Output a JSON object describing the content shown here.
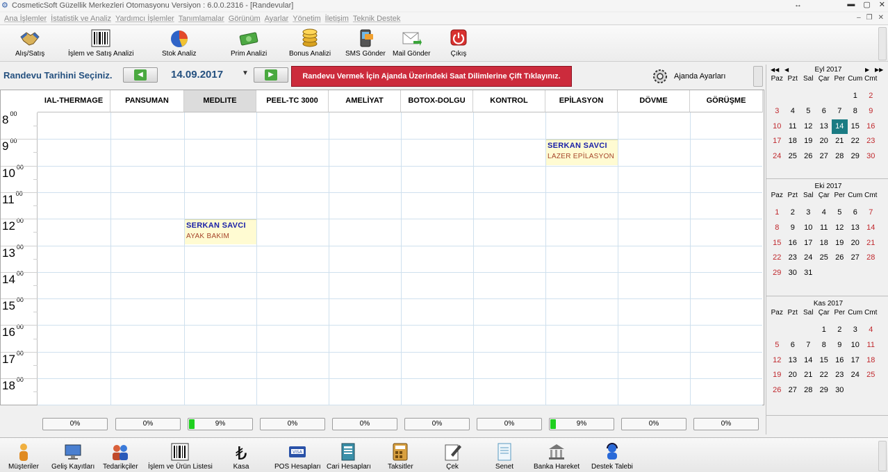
{
  "window": {
    "title": "CosmeticSoft Güzellik Merkezleri Otomasyonu Versiyon : 6.0.0.2316 - [Randevular]"
  },
  "menu": [
    "Ana İşlemler",
    "İstatistik ve Analiz",
    "Yardımcı İşlemler",
    "Tanımlamalar",
    "Görünüm",
    "Ayarlar",
    "Yönetim",
    "İletişim",
    "Teknik Destek"
  ],
  "toolbar": [
    {
      "label": "Alış/Satış",
      "icon": "handshake-icon"
    },
    {
      "label": "İşlem ve Satış Analizi",
      "icon": "barcode-icon"
    },
    {
      "label": "Stok Analiz",
      "icon": "pie-chart-icon"
    },
    {
      "label": "Prim Analizi",
      "icon": "money-icon"
    },
    {
      "label": "Bonus Analizi",
      "icon": "coins-icon"
    },
    {
      "label": "SMS Gönder",
      "icon": "phone-icon"
    },
    {
      "label": "Mail Gönder",
      "icon": "mail-icon"
    },
    {
      "label": "Çıkış",
      "icon": "power-icon"
    }
  ],
  "daterow": {
    "label": "Randevu Tarihini Seçiniz.",
    "date": "14.09.2017",
    "notice": "Randevu Vermek İçin Ajanda Üzerindeki Saat Dilimlerine Çift Tıklayınız.",
    "settings": "Ajanda Ayarları"
  },
  "columns": [
    "IAL-THERMAGE",
    "PANSUMAN",
    "MEDLITE",
    "PEEL-TC 3000",
    "AMELİYAT",
    "BOTOX-DOLGU",
    "KONTROL",
    "EPİLASYON",
    "DÖVME",
    "GÖRÜŞME"
  ],
  "active_column": "MEDLITE",
  "hours": [
    {
      "h": "8",
      "m": "00"
    },
    {
      "h": "9",
      "m": "00"
    },
    {
      "h": "10",
      "m": "00"
    },
    {
      "h": "11",
      "m": "00"
    },
    {
      "h": "12",
      "m": "00"
    },
    {
      "h": "13",
      "m": "00"
    },
    {
      "h": "14",
      "m": "00"
    },
    {
      "h": "15",
      "m": "00"
    },
    {
      "h": "16",
      "m": "00"
    },
    {
      "h": "17",
      "m": "00"
    },
    {
      "h": "18",
      "m": "00"
    }
  ],
  "appointments": [
    {
      "column": "EPİLASYON",
      "hour": "9",
      "name": "SERKAN SAVCI",
      "service": "LAZER EPİLASYON"
    },
    {
      "column": "MEDLITE",
      "hour": "12",
      "name": "SERKAN SAVCI",
      "service": "AYAK BAKIM"
    }
  ],
  "occupancy": [
    {
      "text": "0%",
      "value": 0
    },
    {
      "text": "0%",
      "value": 0
    },
    {
      "text": "9%",
      "value": 9
    },
    {
      "text": "0%",
      "value": 0
    },
    {
      "text": "0%",
      "value": 0
    },
    {
      "text": "0%",
      "value": 0
    },
    {
      "text": "0%",
      "value": 0
    },
    {
      "text": "9%",
      "value": 9
    },
    {
      "text": "0%",
      "value": 0
    },
    {
      "text": "0%",
      "value": 0
    }
  ],
  "calendar": {
    "dows": [
      "Paz",
      "Pzt",
      "Sal",
      "Çar",
      "Per",
      "Cum",
      "Cmt"
    ],
    "months": [
      {
        "title": "Eyl 2017",
        "offset": 5,
        "days": 30,
        "selected": 14,
        "show_nav": true
      },
      {
        "title": "Eki 2017",
        "offset": 0,
        "days": 31,
        "selected": null,
        "show_nav": false
      },
      {
        "title": "Kas 2017",
        "offset": 3,
        "days": 30,
        "selected": null,
        "show_nav": false
      }
    ]
  },
  "bottombar": [
    {
      "label": "Müşteriler",
      "icon": "person-icon"
    },
    {
      "label": "Geliş Kayıtları",
      "icon": "monitor-icon"
    },
    {
      "label": "Tedarikçiler",
      "icon": "group-icon"
    },
    {
      "label": "İşlem ve Ürün Listesi",
      "icon": "barcode-icon"
    },
    {
      "label": "Kasa",
      "icon": "lira-icon"
    },
    {
      "label": "POS Hesapları",
      "icon": "card-icon"
    },
    {
      "label": "Cari Hesapları",
      "icon": "ledger-icon"
    },
    {
      "label": "Taksitler",
      "icon": "calculator-icon"
    },
    {
      "label": "Çek",
      "icon": "cheque-icon"
    },
    {
      "label": "Senet",
      "icon": "document-icon"
    },
    {
      "label": "Banka Hareket",
      "icon": "bank-icon"
    },
    {
      "label": "Destek Talebi",
      "icon": "support-icon"
    }
  ],
  "colors": {
    "accent": "#24507f",
    "notice_bg": "#cc2b3c",
    "selected_day": "#1a7b83",
    "weekend": "#c0282d",
    "appt_bg": "#fffbd2",
    "appt_name": "#1a20a8",
    "appt_service": "#a5442a",
    "progress": "#1fd01f"
  }
}
